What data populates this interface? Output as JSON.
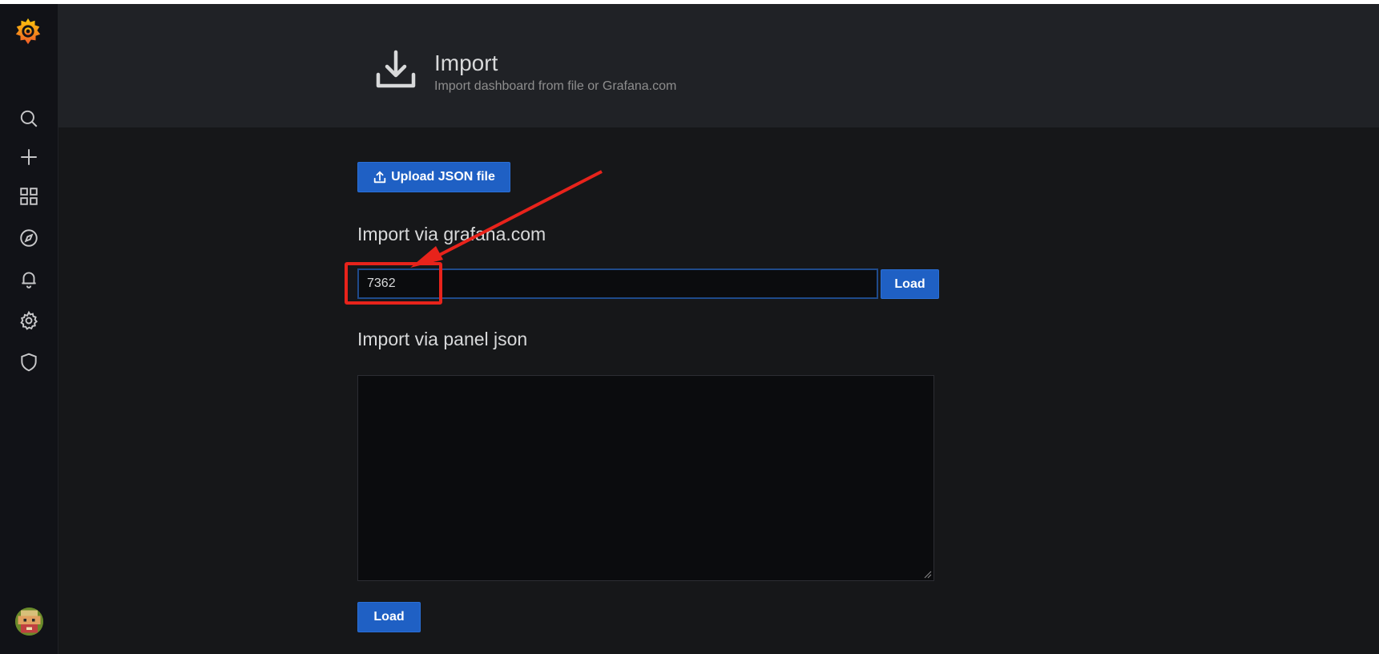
{
  "sidebar": {
    "items": [
      {
        "icon": "search-icon"
      },
      {
        "icon": "plus-icon"
      },
      {
        "icon": "dashboards-icon"
      },
      {
        "icon": "explore-icon"
      },
      {
        "icon": "bell-icon"
      },
      {
        "icon": "gear-icon"
      },
      {
        "icon": "shield-icon"
      }
    ]
  },
  "header": {
    "title": "Import",
    "subtitle": "Import dashboard from file or Grafana.com"
  },
  "upload": {
    "label": "Upload JSON file"
  },
  "grafana_import": {
    "title": "Import via grafana.com",
    "value": "7362",
    "load_label": "Load"
  },
  "panel_json": {
    "title": "Import via panel json",
    "value": "",
    "load_label": "Load"
  },
  "colors": {
    "accent": "#1f60c4",
    "annotation": "#e8231b",
    "background": "#161719"
  }
}
